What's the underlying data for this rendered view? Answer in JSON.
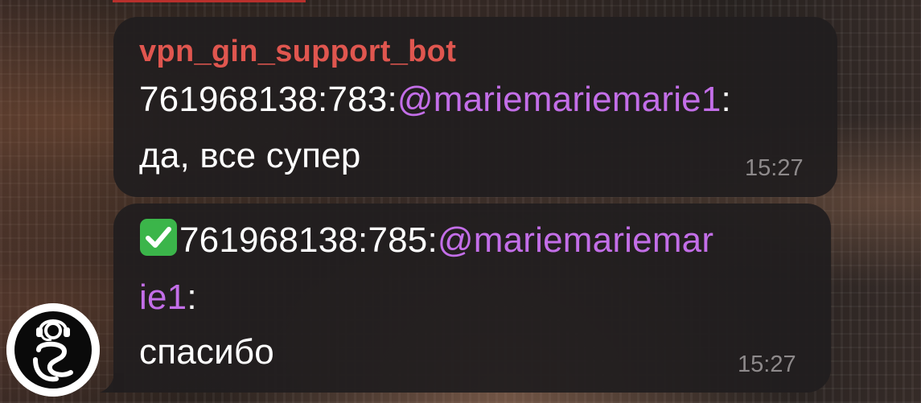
{
  "theme": {
    "bubble_bg": "#211e1f",
    "sender_color": "#e0564f",
    "mention_color": "#c36ee8",
    "time_color": "#8e8a8b"
  },
  "messages": [
    {
      "sender": "vpn_gin_support_bot",
      "line1_id": "761968138:783:",
      "line1_mention": "@mariemariemarie1",
      "line1_suffix": ":",
      "text": "да, все супер",
      "time": "15:27"
    },
    {
      "icon": "check-mark-button-icon",
      "line1_id": "761968138:785:",
      "line1_mention_part1": "@mariemariemar",
      "line2_mention_part2": "ie1",
      "line2_suffix": ":",
      "text": "спасибо",
      "time": "15:27"
    }
  ],
  "avatar": {
    "icon": "support-agent-headset-icon"
  }
}
